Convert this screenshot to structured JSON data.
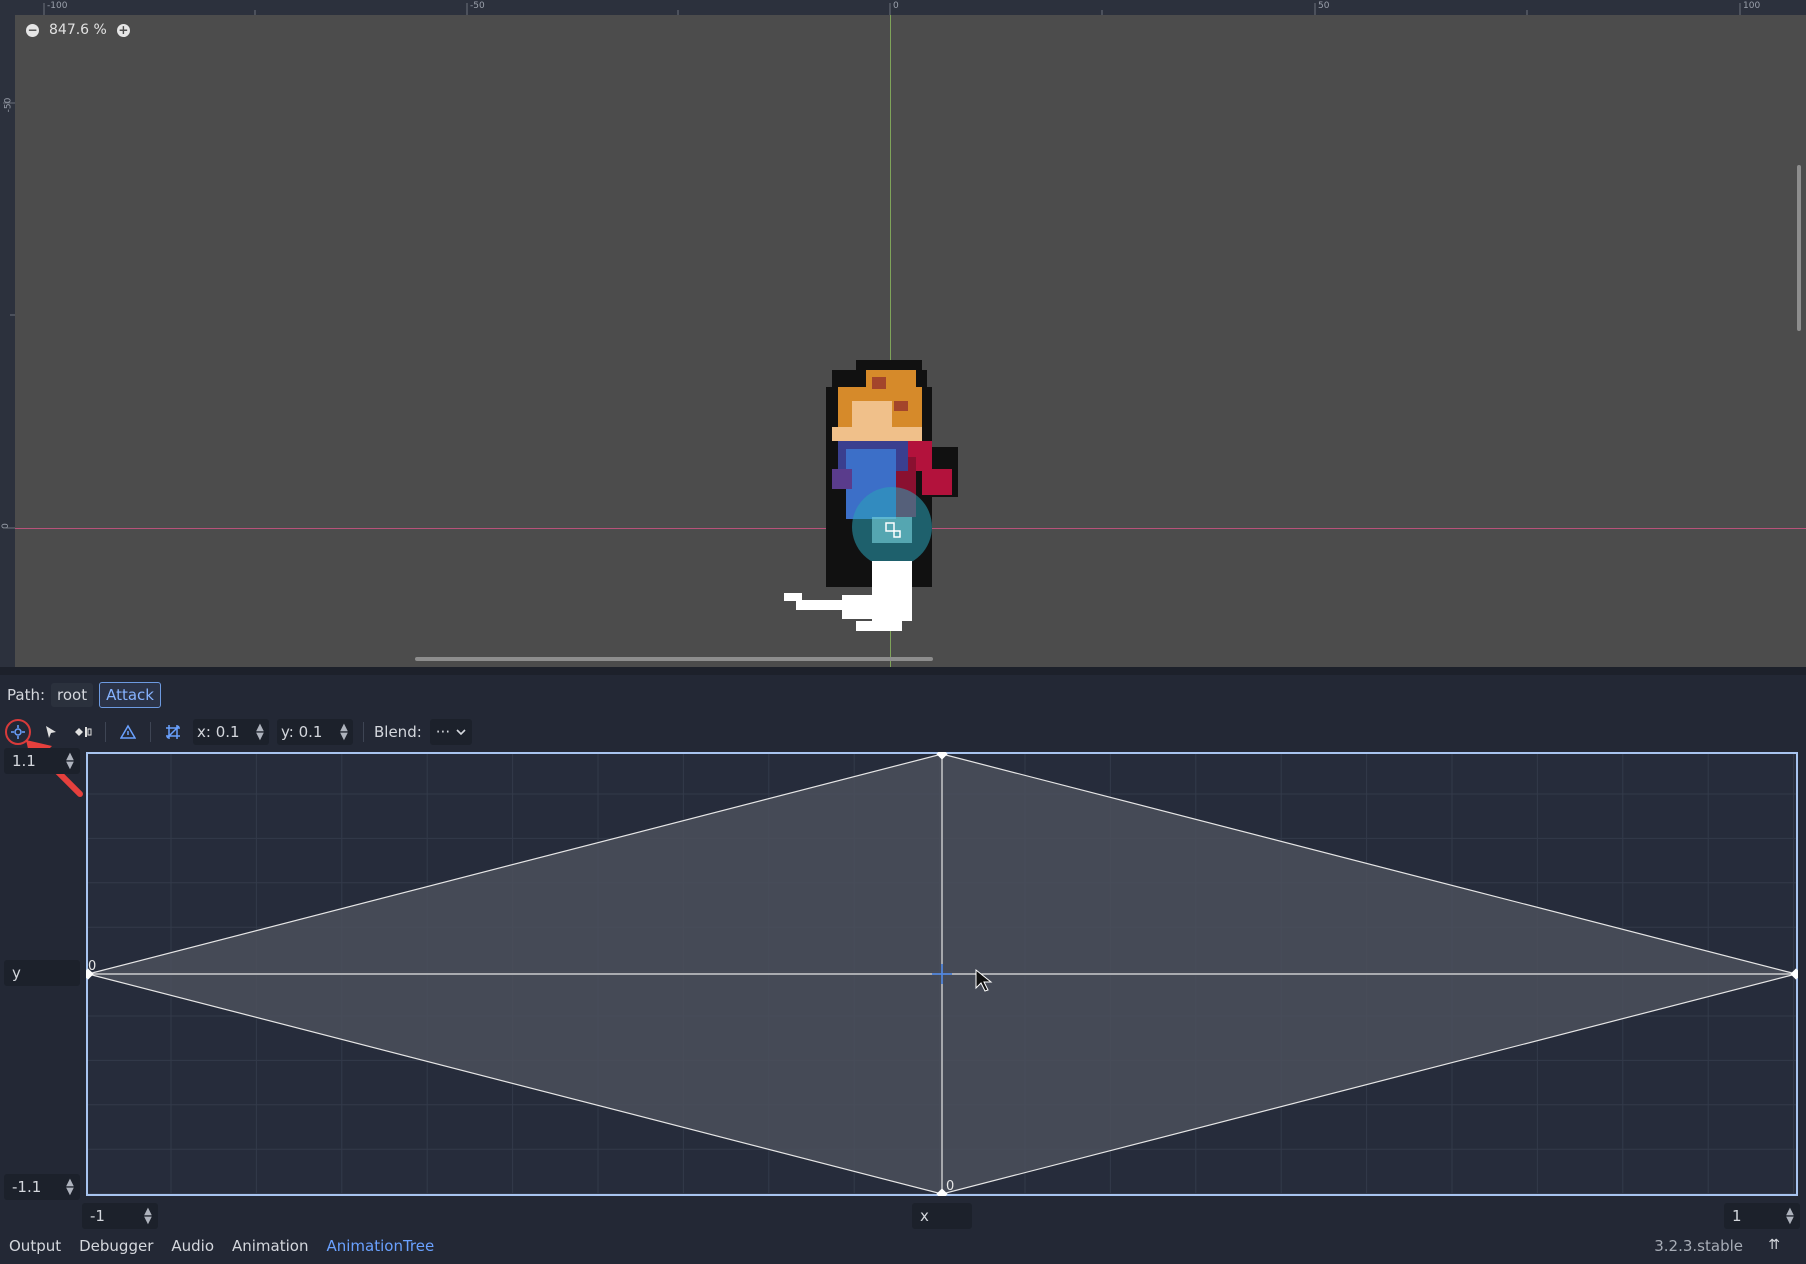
{
  "viewport": {
    "zoom_out_icon": "minus-circle-icon",
    "zoom_in_icon": "plus-circle-icon",
    "zoom_label": "847.6 %",
    "ruler_top_labels": [
      "-100",
      "-50",
      "0",
      "50",
      "100"
    ],
    "ruler_left_labels": [
      "-50",
      "0"
    ],
    "colors": {
      "background": "#4c4c4c",
      "guide_x": "#b8527a",
      "guide_y": "#7fa35a"
    }
  },
  "path_bar": {
    "label": "Path:",
    "crumbs": [
      "root",
      "Attack"
    ]
  },
  "toolbar": {
    "tools": [
      "create-point-icon",
      "select-icon",
      "create-triangle-icon",
      "triangle-warning-icon",
      "snap-icon"
    ],
    "snap_x": "x: 0.1",
    "snap_y": "y: 0.1",
    "blend_label": "Blend:",
    "blend_value": "···"
  },
  "blend_space": {
    "max_y": "1.1",
    "min_y": "-1.1",
    "y_label": "y",
    "min_x": "-1",
    "max_x": "1",
    "x_label": "x",
    "point_label_left": "0",
    "point_label_bottom": "0",
    "colors": {
      "background": "#262c3b",
      "triangle_fill": "#4b505c",
      "border": "#a8c4ef"
    }
  },
  "bottom_tabs": [
    "Output",
    "Debugger",
    "Audio",
    "Animation",
    "AnimationTree"
  ],
  "active_tab": "AnimationTree",
  "version": "3.2.3.stable"
}
